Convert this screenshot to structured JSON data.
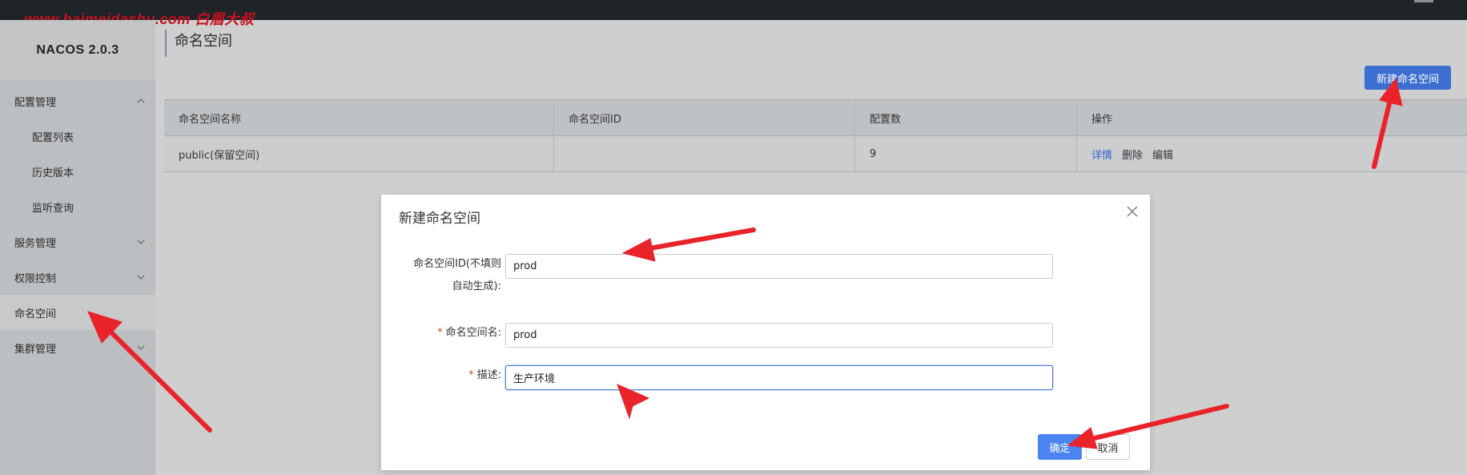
{
  "watermark": "www.baimeidashu.com 白眉大叔",
  "brand": "NACOS 2.0.3",
  "sidebar": {
    "items": [
      {
        "label": "配置管理",
        "chevron": "up"
      },
      {
        "label": "配置列表"
      },
      {
        "label": "历史版本"
      },
      {
        "label": "监听查询"
      },
      {
        "label": "服务管理",
        "chevron": "down"
      },
      {
        "label": "权限控制",
        "chevron": "down"
      },
      {
        "label": "命名空间",
        "active": true
      },
      {
        "label": "集群管理",
        "chevron": "down"
      }
    ]
  },
  "page": {
    "title": "命名空间",
    "new_button": "新建命名空间"
  },
  "table": {
    "headers": [
      "命名空间名称",
      "命名空间ID",
      "配置数",
      "操作"
    ],
    "rows": [
      {
        "name": "public(保留空间)",
        "id": "",
        "count": "9",
        "ops": [
          "详情",
          "删除",
          "编辑"
        ]
      }
    ]
  },
  "dialog": {
    "title": "新建命名空间",
    "id_label_line1": "命名空间ID(不填则",
    "id_label_line2": "自动生成):",
    "id_value": "prod",
    "name_label": "命名空间名:",
    "name_value": "prod",
    "desc_label": "描述:",
    "desc_value": "生产环境",
    "required_mark": "*",
    "ok": "确定",
    "cancel": "取消"
  },
  "colors": {
    "primary": "#3d6fd1",
    "annotation_arrow": "#e8232a",
    "watermark": "#c4111e"
  }
}
